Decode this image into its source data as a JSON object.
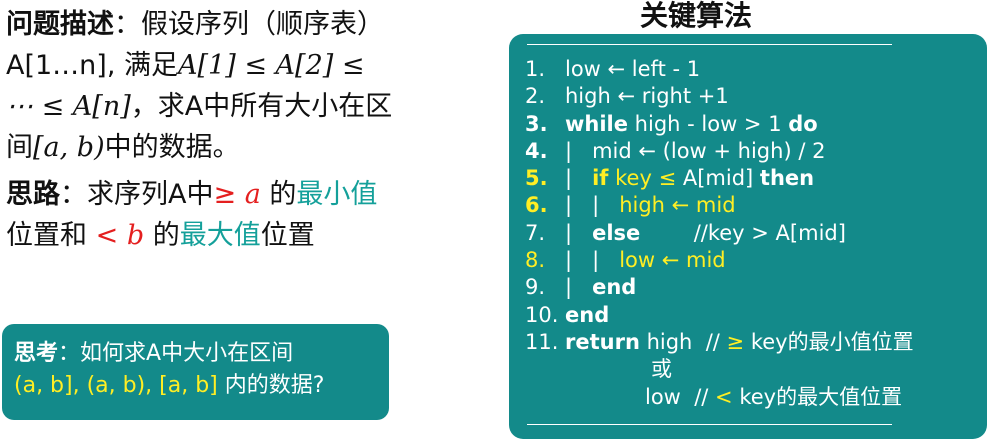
{
  "left": {
    "problem_label": "问题描述",
    "problem_text_1": "：假设序列（顺序表）",
    "problem_text_2a": "A[1…n], 满足",
    "problem_math_2": "A[1] ≤ A[2] ≤",
    "problem_math_3": "⋯ ≤ A[n]",
    "problem_text_3": "，求A中所有大小在区",
    "problem_text_4a": "间",
    "problem_math_4": "[a, b)",
    "problem_text_4b": "中的数据。",
    "idea_label": "思路",
    "idea_text_1": "：求序列A中",
    "idea_ge": "≥",
    "idea_a": "a",
    "idea_de1": " 的",
    "idea_min": "最小值",
    "idea_text_2": "位置和",
    "idea_lt": "<",
    "idea_b": "b",
    "idea_de2": " 的",
    "idea_max": "最大值",
    "idea_pos": "位置"
  },
  "think": {
    "label": "思考",
    "text_1": "：如何求A中大小在区间",
    "text_2_yellow": "(a, b], (a, b), [a, b]",
    "text_2_white": " 内的数据?"
  },
  "algorithm": {
    "title": "关键算法",
    "lines": {
      "l1_n": "1.",
      "l1_t": "low ← left - 1",
      "l2_n": "2.",
      "l2_t": "high ← right +1",
      "l3_n": "3.",
      "l3_k1": "while",
      "l3_t": " high - low > 1 ",
      "l3_k2": "do",
      "l4_n": "4.",
      "l4_t": "|   mid ← (low + high) / 2",
      "l5_n": "5.",
      "l5_bar": "|   ",
      "l5_k1": "if",
      "l5_y": " key ≤ ",
      "l5_t": "A[mid] ",
      "l5_k2": "then",
      "l6_n": "6.",
      "l6_bar": "|   |   ",
      "l6_y": "high ← mid",
      "l7_n": "7.",
      "l7_bar": "|   ",
      "l7_k": "else",
      "l7_t": "        //key > A[mid]",
      "l8_n": "8.",
      "l8_bar": "|   |   ",
      "l8_y": "low ← mid",
      "l9_n": "9.",
      "l9_bar": "|   ",
      "l9_k": "end",
      "l10_n": "10.",
      "l10_k": "end",
      "l11_n": "11.",
      "l11_k": "return",
      "l11_t": " high  // ",
      "l11_y": "≥",
      "l11_c": " key的最小值位置",
      "l12_t": "或",
      "l13_t": "low  // ",
      "l13_y": "<",
      "l13_c": " key的最大值位置"
    }
  }
}
